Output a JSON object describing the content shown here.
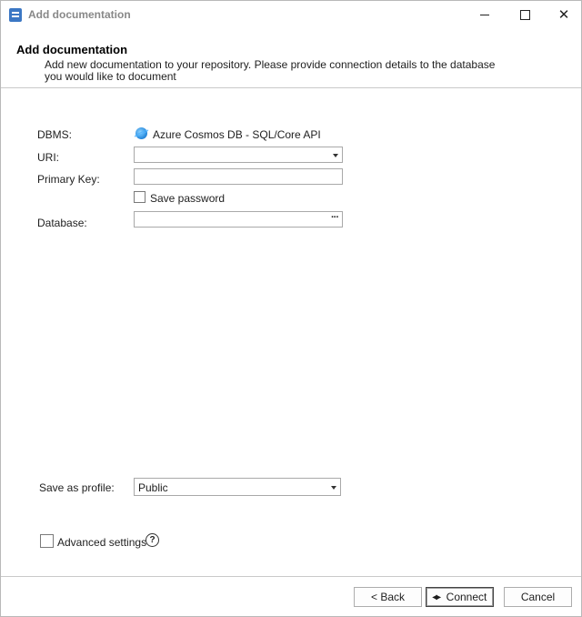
{
  "window": {
    "title": "Add documentation"
  },
  "header": {
    "title": "Add documentation",
    "description": "Add new documentation to your repository. Please provide connection details to the database you would like to document"
  },
  "form": {
    "dbms_label": "DBMS:",
    "dbms_value": "Azure Cosmos DB - SQL/Core API",
    "dbms_icon": "azure-cosmos-db-icon",
    "uri_label": "URI:",
    "uri_value": "",
    "primary_key_label": "Primary Key:",
    "primary_key_value": "",
    "save_password_label": "Save password",
    "save_password_checked": false,
    "database_label": "Database:",
    "database_value": "",
    "database_browse_glyph": "···",
    "profile_label": "Save as profile:",
    "profile_value": "Public",
    "advanced_settings_label": "Advanced settings",
    "advanced_settings_checked": false,
    "help_glyph": "?"
  },
  "footer": {
    "back_label": "< Back",
    "connect_label": "Connect",
    "connect_icon": "plug-connect-icon",
    "cancel_label": "Cancel"
  }
}
